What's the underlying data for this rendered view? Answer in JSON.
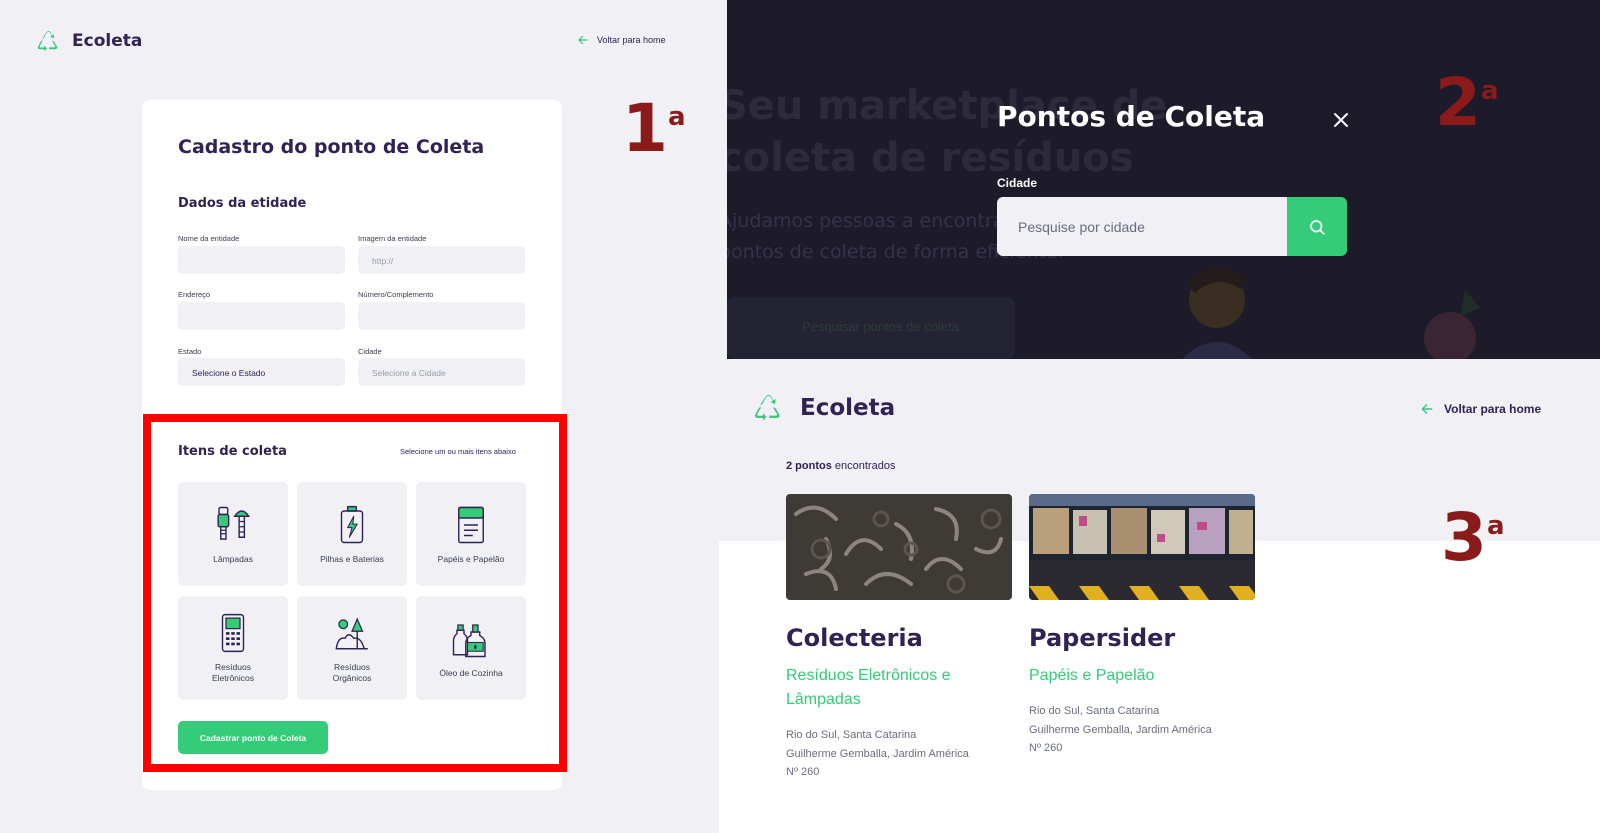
{
  "register": {
    "logo": "Ecoleta",
    "back_link": "Voltar para home",
    "title": "Cadastro do ponto de Coleta",
    "section_entity": "Dados da etidade",
    "fields": {
      "name_label": "Nome da entidade",
      "name_value": "",
      "image_label": "Imagem da entidade",
      "image_placeholder": "http://",
      "address_label": "Endereço",
      "address_value": "",
      "number_label": "Número/Complemento",
      "number_value": "",
      "state_label": "Estado",
      "state_value": "Selecione o Estado",
      "city_label": "Cidade",
      "city_placeholder": "Selecione a Cidade"
    },
    "section_items": "Itens de coleta",
    "items_hint": "Selecione um ou mais itens abaixo",
    "items": [
      {
        "label": "Lâmpadas",
        "icon": "lamps-icon"
      },
      {
        "label": "Pilhas e Baterias",
        "icon": "battery-icon"
      },
      {
        "label": "Papéis e Papelão",
        "icon": "paper-icon"
      },
      {
        "label": "Resíduos\nEletrônicos",
        "icon": "electronics-icon"
      },
      {
        "label": "Resíduos\nOrgânicos",
        "icon": "organic-icon"
      },
      {
        "label": "Óleo de Cozinha",
        "icon": "oil-icon"
      }
    ],
    "submit": "Cadastrar ponto de Coleta",
    "marker": {
      "number": "1",
      "suffix": "a"
    }
  },
  "search_modal": {
    "background_heading": "Seu marketplace de coleta de resíduos",
    "background_text": "Ajudamos pessoas a encontrarem pontos de coleta de forma eficiente.",
    "background_button": "Pesquisar pontos de coleta",
    "title": "Pontos de Coleta",
    "city_label": "Cidade",
    "city_placeholder": "Pesquise por cidade",
    "marker": {
      "number": "2",
      "suffix": "a"
    }
  },
  "results": {
    "logo": "Ecoleta",
    "back_link": "Voltar para home",
    "count": "2 pontos",
    "count_suffix": " encontrados",
    "points": [
      {
        "name": "Colecteria",
        "items": "Resíduos Eletrônicos e Lâmpadas",
        "city": "Rio do Sul, Santa Catarina",
        "street": "Guilherme Gemballa, Jardim América",
        "number": "Nº 260"
      },
      {
        "name": "Papersider",
        "items": "Papéis e Papelão",
        "city": "Rio do Sul, Santa Catarina",
        "street": "Guilherme Gemballa, Jardim América",
        "number": "Nº 260"
      }
    ],
    "marker": {
      "number": "3",
      "suffix": "a"
    }
  },
  "colors": {
    "primary": "#34CB79",
    "title": "#322153",
    "background": "#F0F0F5",
    "text": "#6C6C80",
    "marker": "#8B1A1A",
    "highlight_border": "#FF0000"
  }
}
